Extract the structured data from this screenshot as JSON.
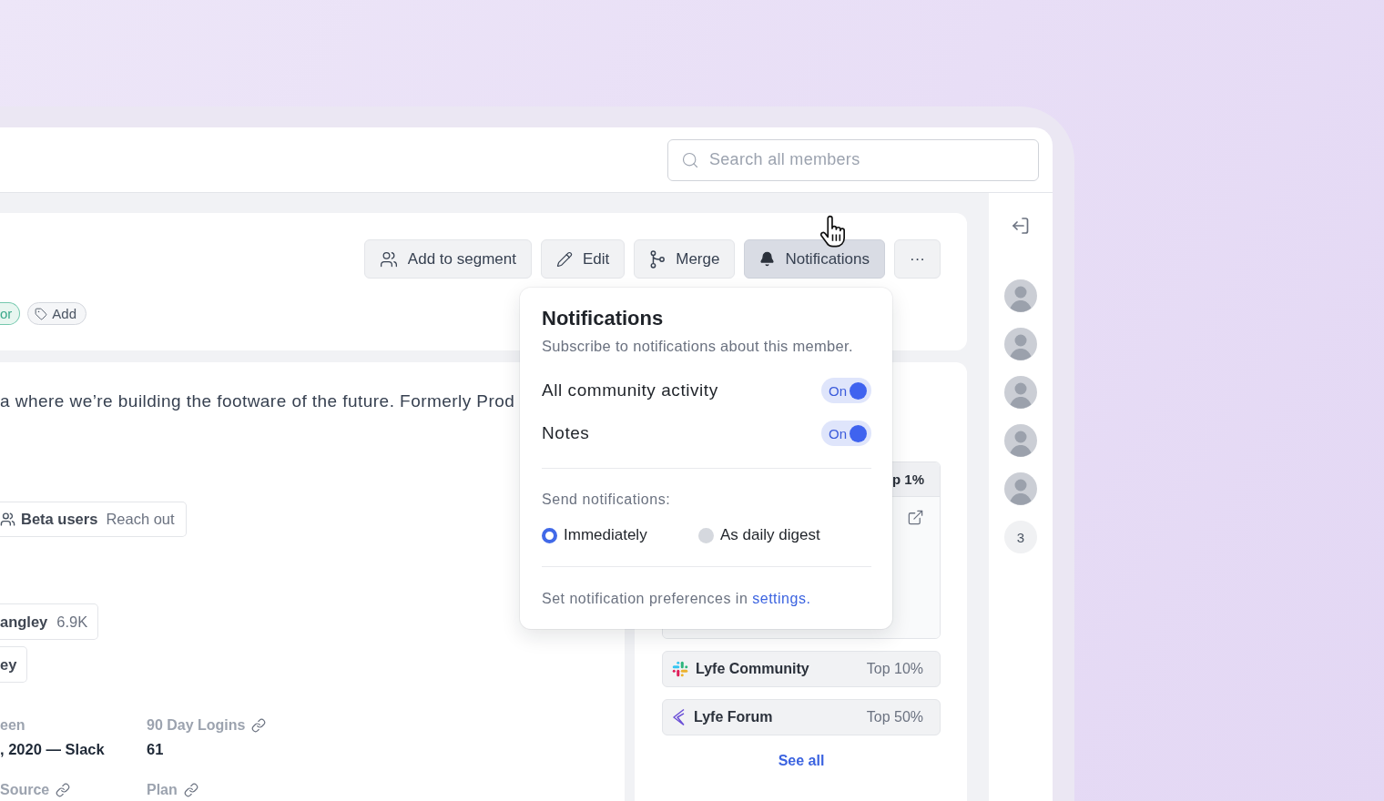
{
  "search": {
    "placeholder": "Search all members"
  },
  "toolbar": [
    {
      "kind": "segment",
      "label": "Add to segment",
      "selected": false
    },
    {
      "kind": "edit",
      "label": "Edit",
      "selected": false
    },
    {
      "kind": "merge",
      "label": "Merge",
      "selected": false
    },
    {
      "kind": "notifications",
      "label": "Notifications",
      "selected": true
    },
    {
      "kind": "more",
      "label": "···",
      "selected": false
    }
  ],
  "tags": [
    {
      "kind": "role",
      "label": "or"
    },
    {
      "kind": "add",
      "label": "Add"
    }
  ],
  "bio": "a where we’re building the footware of the future. Formerly Prod",
  "segments": [
    {
      "name": "Beta users",
      "action": "Reach out"
    }
  ],
  "accounts": [
    {
      "name": "angley",
      "count": "6.9K"
    },
    {
      "name": "ey"
    }
  ],
  "stats": [
    {
      "label": "een",
      "value": ", 2020 — Slack",
      "linked": false
    },
    {
      "label": "90 Day Logins",
      "value": "61",
      "linked": true
    },
    {
      "label": "Source",
      "linked": true
    },
    {
      "label": "Plan",
      "linked": true
    }
  ],
  "communities": {
    "items": [
      {
        "rank": "p 1%",
        "expanded": true
      },
      {
        "kind": "slack",
        "name": "Lyfe Community",
        "rank": "Top 10%",
        "expanded": false
      },
      {
        "kind": "forum",
        "name": "Lyfe Forum",
        "rank": "Top 50%",
        "expanded": false
      }
    ],
    "see_all": "See all"
  },
  "notifications_popup": {
    "title": "Notifications",
    "subtitle": "Subscribe to notifications about this member.",
    "subscriptions": [
      {
        "label": "All community activity",
        "on": true,
        "state_label": "On"
      },
      {
        "label": "Notes",
        "on": true,
        "state_label": "On"
      }
    ],
    "send_label": "Send notifications:",
    "options": [
      {
        "label": "Immediately",
        "selected": true
      },
      {
        "label": "As daily digest",
        "selected": false
      }
    ],
    "footer": "Set notification preferences in",
    "footer_link": "settings."
  },
  "sidebar": {
    "people": [
      {
        "kind": "avatar"
      },
      {
        "kind": "avatar"
      },
      {
        "kind": "avatar"
      },
      {
        "kind": "avatar"
      },
      {
        "kind": "avatar"
      },
      {
        "kind": "count",
        "label": "3"
      }
    ]
  }
}
